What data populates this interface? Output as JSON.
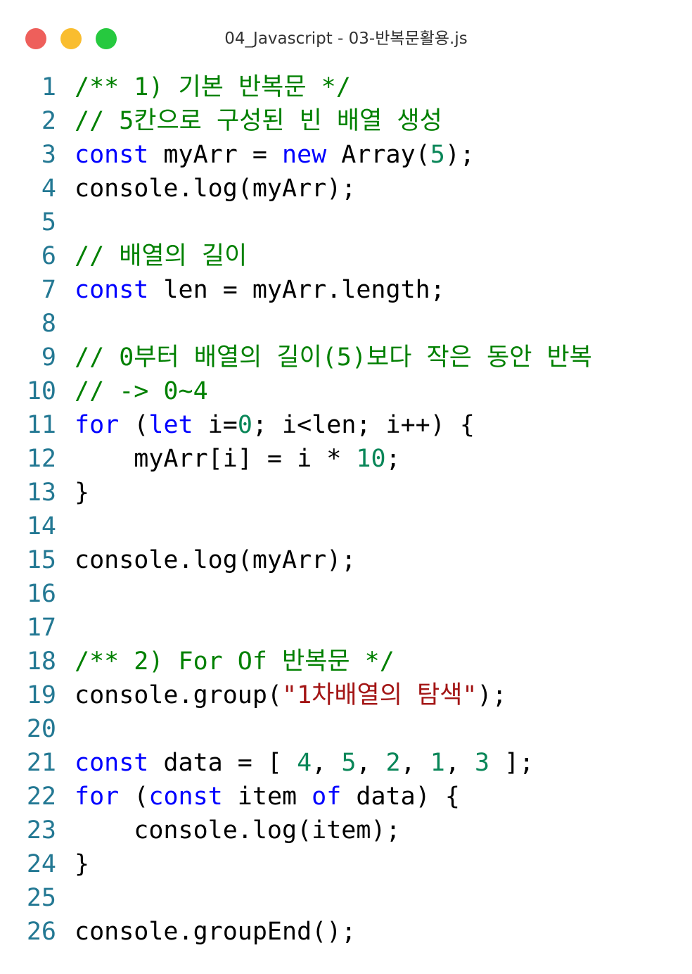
{
  "window": {
    "title": "04_Javascript - 03-반복문활용.js",
    "buttons": [
      {
        "name": "close",
        "color": "#ee5f5b"
      },
      {
        "name": "minimize",
        "color": "#f9bd2f"
      },
      {
        "name": "maximize",
        "color": "#26c93f"
      }
    ]
  },
  "code": {
    "lines": [
      {
        "n": "1",
        "tokens": [
          [
            "comment",
            "/** 1) 기본 반복문 */"
          ]
        ]
      },
      {
        "n": "2",
        "tokens": [
          [
            "comment",
            "// 5칸으로 구성된 빈 배열 생성"
          ]
        ]
      },
      {
        "n": "3",
        "tokens": [
          [
            "keyword",
            "const"
          ],
          [
            "plain",
            " myArr = "
          ],
          [
            "keyword",
            "new"
          ],
          [
            "plain",
            " Array("
          ],
          [
            "number",
            "5"
          ],
          [
            "plain",
            ");"
          ]
        ]
      },
      {
        "n": "4",
        "tokens": [
          [
            "plain",
            "console.log(myArr);"
          ]
        ]
      },
      {
        "n": "5",
        "tokens": []
      },
      {
        "n": "6",
        "tokens": [
          [
            "comment",
            "// 배열의 길이"
          ]
        ]
      },
      {
        "n": "7",
        "tokens": [
          [
            "keyword",
            "const"
          ],
          [
            "plain",
            " len = myArr.length;"
          ]
        ]
      },
      {
        "n": "8",
        "tokens": []
      },
      {
        "n": "9",
        "tokens": [
          [
            "comment",
            "// 0부터 배열의 길이(5)보다 작은 동안 반복"
          ]
        ]
      },
      {
        "n": "10",
        "tokens": [
          [
            "comment",
            "// -> 0~4"
          ]
        ]
      },
      {
        "n": "11",
        "tokens": [
          [
            "keyword",
            "for"
          ],
          [
            "plain",
            " ("
          ],
          [
            "keyword",
            "let"
          ],
          [
            "plain",
            " i="
          ],
          [
            "number",
            "0"
          ],
          [
            "plain",
            "; i<len; i++) {"
          ]
        ]
      },
      {
        "n": "12",
        "tokens": [
          [
            "plain",
            "    myArr[i] = i * "
          ],
          [
            "number",
            "10"
          ],
          [
            "plain",
            ";"
          ]
        ]
      },
      {
        "n": "13",
        "tokens": [
          [
            "plain",
            "}"
          ]
        ]
      },
      {
        "n": "14",
        "tokens": []
      },
      {
        "n": "15",
        "tokens": [
          [
            "plain",
            "console.log(myArr);"
          ]
        ]
      },
      {
        "n": "16",
        "tokens": []
      },
      {
        "n": "17",
        "tokens": []
      },
      {
        "n": "18",
        "tokens": [
          [
            "comment",
            "/** 2) For Of 반복문 */"
          ]
        ]
      },
      {
        "n": "19",
        "tokens": [
          [
            "plain",
            "console.group("
          ],
          [
            "string",
            "\"1차배열의 탐색\""
          ],
          [
            "plain",
            ");"
          ]
        ]
      },
      {
        "n": "20",
        "tokens": []
      },
      {
        "n": "21",
        "tokens": [
          [
            "keyword",
            "const"
          ],
          [
            "plain",
            " data = [ "
          ],
          [
            "number",
            "4"
          ],
          [
            "plain",
            ", "
          ],
          [
            "number",
            "5"
          ],
          [
            "plain",
            ", "
          ],
          [
            "number",
            "2"
          ],
          [
            "plain",
            ", "
          ],
          [
            "number",
            "1"
          ],
          [
            "plain",
            ", "
          ],
          [
            "number",
            "3"
          ],
          [
            "plain",
            " ];"
          ]
        ]
      },
      {
        "n": "22",
        "tokens": [
          [
            "keyword",
            "for"
          ],
          [
            "plain",
            " ("
          ],
          [
            "keyword",
            "const"
          ],
          [
            "plain",
            " item "
          ],
          [
            "keyword",
            "of"
          ],
          [
            "plain",
            " data) {"
          ]
        ]
      },
      {
        "n": "23",
        "tokens": [
          [
            "plain",
            "    console.log(item);"
          ]
        ]
      },
      {
        "n": "24",
        "tokens": [
          [
            "plain",
            "}"
          ]
        ]
      },
      {
        "n": "25",
        "tokens": []
      },
      {
        "n": "26",
        "tokens": [
          [
            "plain",
            "console.groupEnd();"
          ]
        ]
      }
    ]
  }
}
